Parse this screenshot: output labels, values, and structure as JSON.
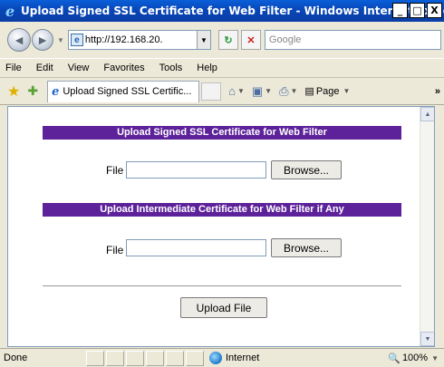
{
  "window": {
    "title": "Upload Signed SSL Certificate for Web Filter - Windows Internet Explorer",
    "minimize": "_",
    "maximize": "□",
    "close": "X"
  },
  "toolbar": {
    "back_glyph": "◄",
    "forward_glyph": "►",
    "address": "http://192.168.20.",
    "refresh_glyph": "↻",
    "stop_glyph": "✕",
    "search_placeholder": "Google"
  },
  "menu": [
    "File",
    "Edit",
    "View",
    "Favorites",
    "Tools",
    "Help"
  ],
  "favbar": {
    "tab_title": "Upload Signed SSL Certific...",
    "page_label": "Page",
    "overflow": "»"
  },
  "page": {
    "header1": "Upload Signed SSL Certificate for Web Filter",
    "header2": "Upload Intermediate Certificate for Web Filter if Any",
    "file_label": "File",
    "browse_label": "Browse...",
    "upload_label": "Upload File"
  },
  "status": {
    "text": "Done",
    "zone": "Internet",
    "zoom": "100%"
  }
}
